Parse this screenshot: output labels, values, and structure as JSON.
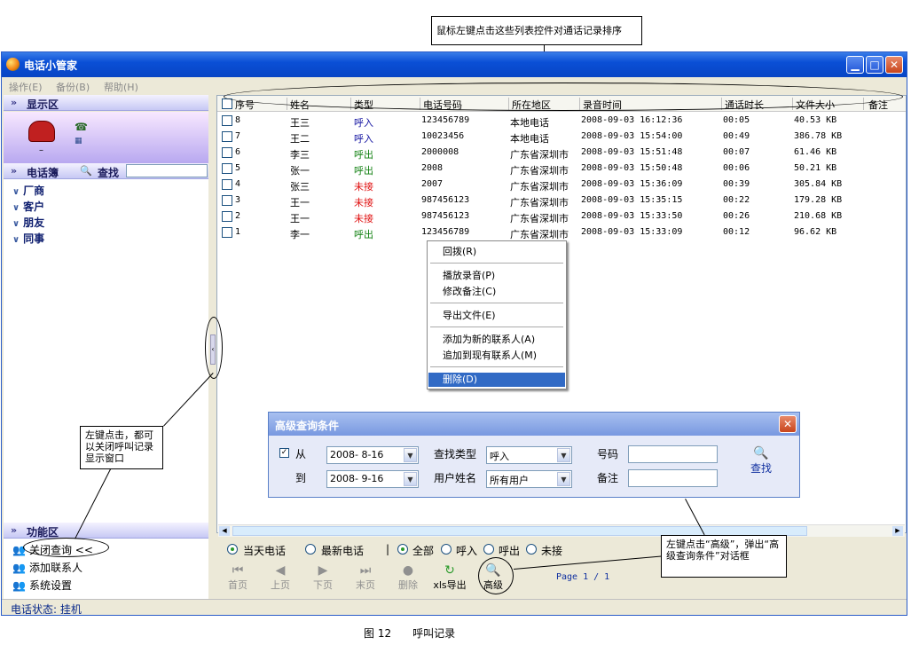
{
  "annotations": {
    "top": "鼠标左键点击这些列表控件对通话记录排序",
    "left": "左键点击，都可以关闭呼叫记录显示窗口",
    "right": "左键点击“高级”，弹出“高级查询条件”对话框",
    "caption": "图 12　　呼叫记录"
  },
  "window": {
    "title": "电话小管家",
    "menu": [
      "操作(E)",
      "备份(B)",
      "帮助(H)"
    ]
  },
  "left": {
    "display_header": "显示区",
    "phonebook_header": "电话簿",
    "search_label": "查找",
    "groups": [
      "厂商",
      "客户",
      "朋友",
      "同事"
    ],
    "func_header": "功能区",
    "func_items": [
      "关闭查询 <<",
      "添加联系人",
      "系统设置"
    ]
  },
  "status": "电话状态: 挂机",
  "list": {
    "columns": [
      "序号",
      "姓名",
      "类型",
      "电话号码",
      "所在地区",
      "录音时间",
      "通话时长",
      "文件大小",
      "备注"
    ],
    "rows": [
      {
        "no": "8",
        "name": "王三",
        "type": "呼入",
        "kind": "in",
        "phone": "123456789",
        "area": "本地电话",
        "time": "2008-09-03 16:12:36",
        "dur": "00:05",
        "size": "40.53 KB"
      },
      {
        "no": "7",
        "name": "王二",
        "type": "呼入",
        "kind": "in",
        "phone": "10023456",
        "area": "本地电话",
        "time": "2008-09-03 15:54:00",
        "dur": "00:49",
        "size": "386.78 KB"
      },
      {
        "no": "6",
        "name": "李三",
        "type": "呼出",
        "kind": "out",
        "phone": "2000008",
        "area": "广东省深圳市",
        "time": "2008-09-03 15:51:48",
        "dur": "00:07",
        "size": "61.46 KB"
      },
      {
        "no": "5",
        "name": "张一",
        "type": "呼出",
        "kind": "out",
        "phone": "2008",
        "area": "广东省深圳市",
        "time": "2008-09-03 15:50:48",
        "dur": "00:06",
        "size": "50.21 KB"
      },
      {
        "no": "4",
        "name": "张三",
        "type": "未接",
        "kind": "miss",
        "phone": "2007",
        "area": "广东省深圳市",
        "time": "2008-09-03 15:36:09",
        "dur": "00:39",
        "size": "305.84 KB"
      },
      {
        "no": "3",
        "name": "王一",
        "type": "未接",
        "kind": "miss",
        "phone": "987456123",
        "area": "广东省深圳市",
        "time": "2008-09-03 15:35:15",
        "dur": "00:22",
        "size": "179.28 KB"
      },
      {
        "no": "2",
        "name": "王一",
        "type": "未接",
        "kind": "miss",
        "phone": "987456123",
        "area": "广东省深圳市",
        "time": "2008-09-03 15:33:50",
        "dur": "00:26",
        "size": "210.68 KB"
      },
      {
        "no": "1",
        "name": "李一",
        "type": "呼出",
        "kind": "out",
        "phone": "123456789",
        "area": "广东省深圳市",
        "time": "2008-09-03 15:33:09",
        "dur": "00:12",
        "size": "96.62 KB"
      }
    ]
  },
  "context_menu": [
    "回拨(R)",
    "播放录音(P)",
    "修改备注(C)",
    "导出文件(E)",
    "添加为新的联系人(A)",
    "追加到现有联系人(M)",
    "删除(D)"
  ],
  "filters": {
    "range": [
      "当天电话",
      "最新电话"
    ],
    "separator": "|",
    "types": [
      "全部",
      "呼入",
      "呼出",
      "未接"
    ]
  },
  "toolbar": {
    "buttons": [
      "首页",
      "上页",
      "下页",
      "末页",
      "删除",
      "xls导出",
      "高级"
    ],
    "page": "Page 1 / 1"
  },
  "advanced": {
    "title": "高级查询条件",
    "from_label": "从",
    "from_date": "2008- 8-16",
    "to_label": "到",
    "to_date": "2008- 9-16",
    "type_label": "查找类型",
    "type_value": "呼入",
    "user_label": "用户姓名",
    "user_value": "所有用户",
    "number_label": "号码",
    "note_label": "备注",
    "search_button": "查找"
  },
  "colors": {
    "title_blue": "#0a4fd6",
    "call_in": "#1010a0",
    "call_out": "#108010",
    "call_missed": "#e01010",
    "menu_selected": "#316ac5"
  }
}
